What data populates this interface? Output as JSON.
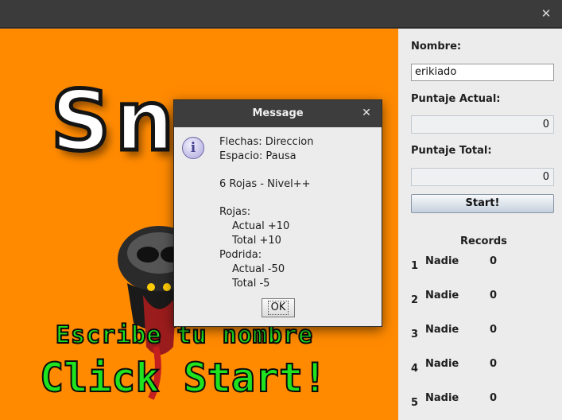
{
  "window": {
    "close_icon": "close-icon",
    "close_glyph": "✕"
  },
  "game_area": {
    "background_color": "#ff8a00",
    "logo_text": "Sn",
    "prompt_name": "Escribe tu nombre",
    "prompt_start": "Click Start!",
    "prompt_color": "#1ee31e"
  },
  "panel": {
    "name_label": "Nombre:",
    "name_value": "erikiado",
    "score_current_label": "Puntaje Actual:",
    "score_current_value": "0",
    "score_total_label": "Puntaje Total:",
    "score_total_value": "0",
    "start_label": "Start!",
    "records_title": "Records",
    "records": [
      {
        "rank": "1",
        "name": "Nadie",
        "score": "0"
      },
      {
        "rank": "2",
        "name": "Nadie",
        "score": "0"
      },
      {
        "rank": "3",
        "name": "Nadie",
        "score": "0"
      },
      {
        "rank": "4",
        "name": "Nadie",
        "score": "0"
      },
      {
        "rank": "5",
        "name": "Nadie",
        "score": "0"
      }
    ]
  },
  "dialog": {
    "title": "Message",
    "close_glyph": "✕",
    "icon": "info-icon",
    "icon_glyph": "i",
    "lines": [
      "Flechas: Direccion",
      "Espacio: Pausa",
      "6 Rojas - Nivel++",
      "Rojas:",
      "Actual +10",
      "Total +10",
      "Podrida:",
      "Actual -50",
      "Total -5"
    ],
    "ok_label": "OK"
  }
}
